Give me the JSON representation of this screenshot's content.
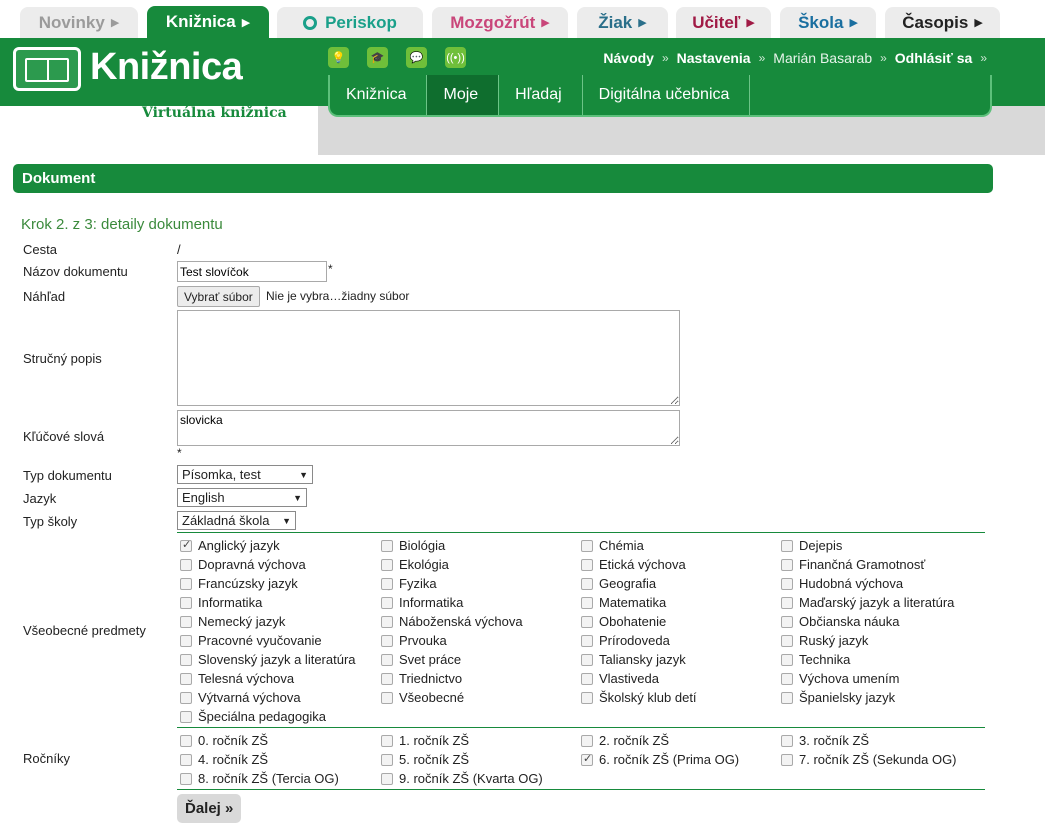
{
  "top_tabs": [
    {
      "label": "Novinky",
      "arrow": "▶",
      "color": "#9b9b9b"
    },
    {
      "label": "Knižnica",
      "arrow": "▶",
      "color": "#ffffff"
    },
    {
      "label": "Periskop",
      "arrow": "",
      "color": "#1aa08a"
    },
    {
      "label": "Mozgožrút",
      "arrow": "▶",
      "color": "#c9467a"
    },
    {
      "label": "Žiak",
      "arrow": "▶",
      "color": "#2a6f8a"
    },
    {
      "label": "Učiteľ",
      "arrow": "▶",
      "color": "#a01a45"
    },
    {
      "label": "Škola",
      "arrow": "▶",
      "color": "#1a6fa0"
    },
    {
      "label": "Časopis",
      "arrow": "▶",
      "color": "#222222"
    }
  ],
  "header": {
    "logo_text": "Knižnica",
    "subtitle": "Virtuálna knižnica",
    "user_links": [
      "Návody",
      "Nastavenia",
      "Marián Basarab",
      "Odhlásiť sa"
    ],
    "separator": "»",
    "icons": [
      "lightbulb-icon",
      "graduation-cap-icon",
      "chat-icon",
      "broadcast-icon"
    ]
  },
  "subnav": [
    "Knižnica",
    "Moje",
    "Hľadaj",
    "Digitálna učebnica"
  ],
  "section_title": "Dokument",
  "step_title": "Krok 2. z 3: detaily dokumentu",
  "form": {
    "path_label": "Cesta",
    "path_value": "/",
    "name_label": "Názov dokumentu",
    "name_value": "Test slovíčok",
    "preview_label": "Náhľad",
    "file_button": "Vybrať súbor",
    "file_status": "Nie je vybra…žiadny súbor",
    "desc_label": "Stručný popis",
    "desc_value": "",
    "keywords_label": "Kľúčové slová",
    "keywords_value": "slovicka",
    "required": "*",
    "doc_type_label": "Typ dokumentu",
    "doc_type_value": "Písomka, test",
    "lang_label": "Jazyk",
    "lang_value": "English",
    "school_label": "Typ školy",
    "school_value": "Základná škola",
    "subjects_label": "Všeobecné predmety",
    "grades_label": "Ročníky",
    "next_button": "Ďalej »"
  },
  "subjects": [
    {
      "label": "Anglický jazyk",
      "checked": true
    },
    {
      "label": "Biológia",
      "checked": false
    },
    {
      "label": "Chémia",
      "checked": false
    },
    {
      "label": "Dejepis",
      "checked": false
    },
    {
      "label": "Dopravná výchova",
      "checked": false
    },
    {
      "label": "Ekológia",
      "checked": false
    },
    {
      "label": "Etická výchova",
      "checked": false
    },
    {
      "label": "Finančná Gramotnosť",
      "checked": false
    },
    {
      "label": "Francúzsky jazyk",
      "checked": false
    },
    {
      "label": "Fyzika",
      "checked": false
    },
    {
      "label": "Geografia",
      "checked": false
    },
    {
      "label": "Hudobná výchova",
      "checked": false
    },
    {
      "label": "Informatika",
      "checked": false
    },
    {
      "label": "Informatika",
      "checked": false
    },
    {
      "label": "Matematika",
      "checked": false
    },
    {
      "label": "Maďarský jazyk a literatúra",
      "checked": false
    },
    {
      "label": "Nemecký jazyk",
      "checked": false
    },
    {
      "label": "Náboženská výchova",
      "checked": false
    },
    {
      "label": "Obohatenie",
      "checked": false
    },
    {
      "label": "Občianska náuka",
      "checked": false
    },
    {
      "label": "Pracovné vyučovanie",
      "checked": false
    },
    {
      "label": "Prvouka",
      "checked": false
    },
    {
      "label": "Prírodoveda",
      "checked": false
    },
    {
      "label": "Ruský jazyk",
      "checked": false
    },
    {
      "label": "Slovenský jazyk a literatúra",
      "checked": false
    },
    {
      "label": "Svet práce",
      "checked": false
    },
    {
      "label": "Taliansky jazyk",
      "checked": false
    },
    {
      "label": "Technika",
      "checked": false
    },
    {
      "label": "Telesná výchova",
      "checked": false
    },
    {
      "label": "Triednictvo",
      "checked": false
    },
    {
      "label": "Vlastiveda",
      "checked": false
    },
    {
      "label": "Výchova umením",
      "checked": false
    },
    {
      "label": "Výtvarná výchova",
      "checked": false
    },
    {
      "label": "Všeobecné",
      "checked": false
    },
    {
      "label": "Školský klub detí",
      "checked": false
    },
    {
      "label": "Španielsky jazyk",
      "checked": false
    },
    {
      "label": "Špeciálna pedagogika",
      "checked": false
    }
  ],
  "grades": [
    {
      "label": "0. ročník ZŠ",
      "checked": false
    },
    {
      "label": "1. ročník ZŠ",
      "checked": false
    },
    {
      "label": "2. ročník ZŠ",
      "checked": false
    },
    {
      "label": "3. ročník ZŠ",
      "checked": false
    },
    {
      "label": "4. ročník ZŠ",
      "checked": false
    },
    {
      "label": "5. ročník ZŠ",
      "checked": false
    },
    {
      "label": "6. ročník ZŠ (Prima OG)",
      "checked": true
    },
    {
      "label": "7. ročník ZŠ (Sekunda OG)",
      "checked": false
    },
    {
      "label": "8. ročník ZŠ (Tercia OG)",
      "checked": false
    },
    {
      "label": "9. ročník ZŠ (Kvarta OG)",
      "checked": false
    }
  ],
  "colors": {
    "brand_green": "#178a3c",
    "step_text": "#3b8a3c"
  }
}
